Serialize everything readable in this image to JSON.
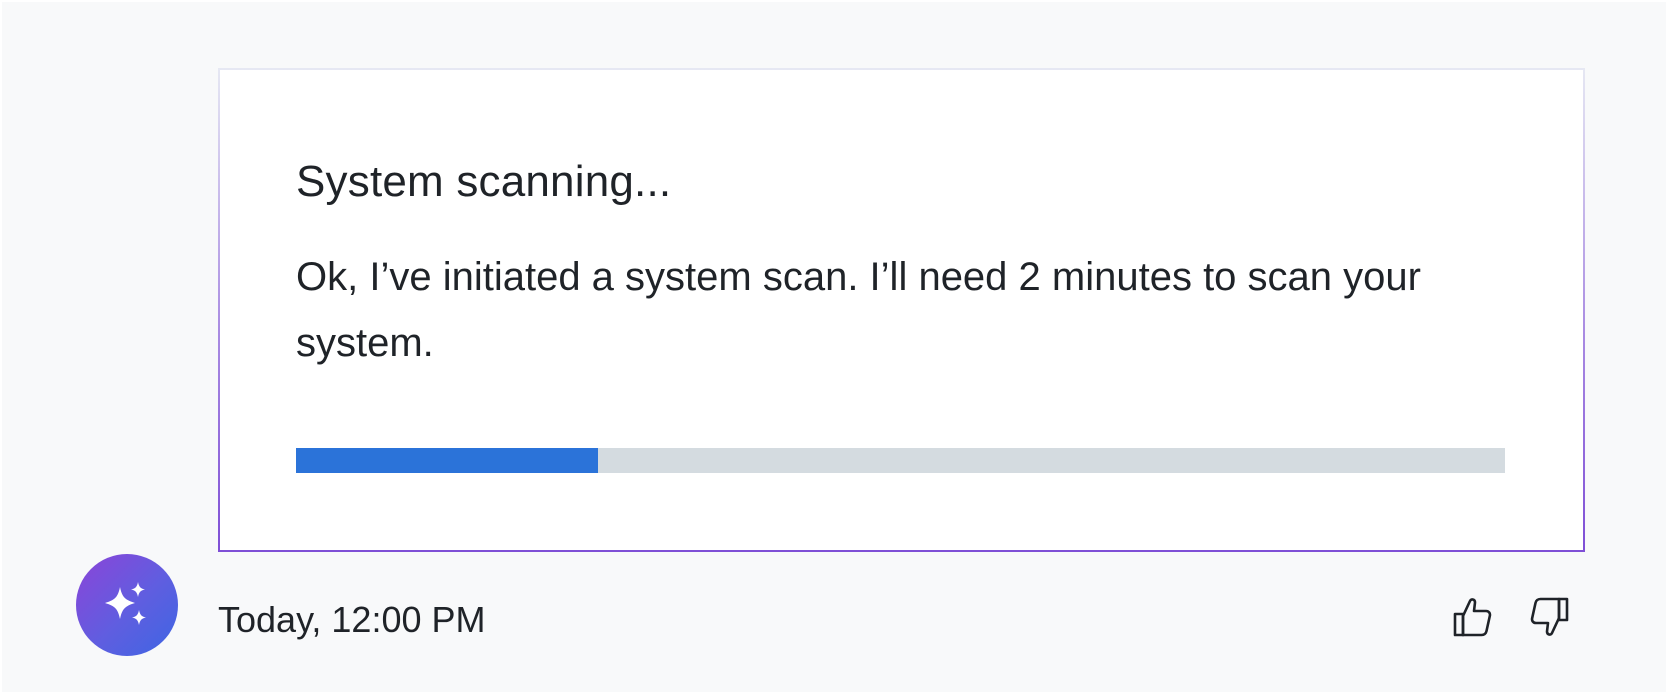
{
  "message": {
    "title": "System scanning...",
    "body": "Ok, I’ve initiated a system scan. I’ll need 2 minutes to scan your system.",
    "progress_fraction": 0.25,
    "progress_color": "#2b73d9",
    "track_color": "#d4dbe0"
  },
  "meta": {
    "timestamp": "Today, 12:00 PM"
  },
  "icons": {
    "avatar": "sparkles-icon",
    "feedback_positive": "thumbs-up-icon",
    "feedback_negative": "thumbs-down-icon"
  },
  "colors": {
    "border_gradient_end": "#7f4fd6",
    "avatar_gradient_start": "#8c44d8",
    "avatar_gradient_end": "#3d66e3"
  }
}
